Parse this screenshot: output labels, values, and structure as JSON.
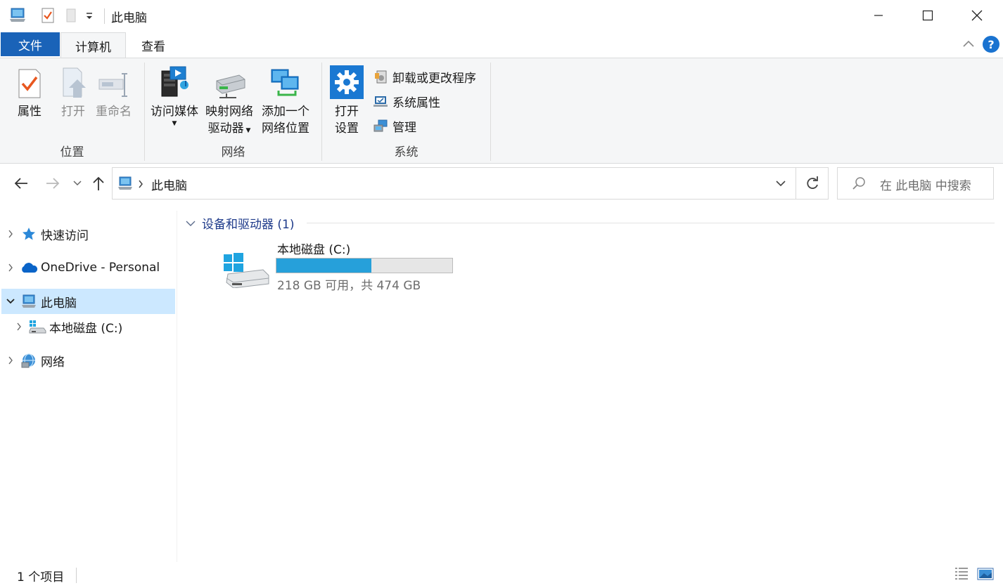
{
  "window": {
    "title": "此电脑"
  },
  "tabs": [
    {
      "label": "文件"
    },
    {
      "label": "计算机"
    },
    {
      "label": "查看"
    }
  ],
  "ribbon": {
    "help_label": "?",
    "groups": {
      "location": {
        "label": "位置",
        "properties": "属性",
        "open": "打开",
        "rename": "重命名"
      },
      "network": {
        "label": "网络",
        "access_media": "访问媒体",
        "map_drive_1": "映射网络",
        "map_drive_2": "驱动器",
        "add_location_1": "添加一个",
        "add_location_2": "网络位置"
      },
      "system": {
        "label": "系统",
        "open_settings_1": "打开",
        "open_settings_2": "设置",
        "uninstall": "卸载或更改程序",
        "sys_props": "系统属性",
        "manage": "管理"
      }
    }
  },
  "address": {
    "path": "此电脑",
    "search_placeholder": "在 此电脑 中搜索"
  },
  "nav": {
    "items": [
      {
        "label": "快速访问",
        "icon": "star-icon"
      },
      {
        "label": "OneDrive - Personal",
        "icon": "cloud-icon"
      },
      {
        "label": "此电脑",
        "icon": "computer-icon"
      },
      {
        "label": "本地磁盘 (C:)",
        "icon": "drive-icon"
      },
      {
        "label": "网络",
        "icon": "network-icon"
      }
    ]
  },
  "content": {
    "group_header": "设备和驱动器 (1)",
    "drives": [
      {
        "name": "本地磁盘 (C:)",
        "info": "218 GB 可用，共 474 GB",
        "used_fraction": 0.54
      }
    ]
  },
  "status": {
    "count": "1 个项目"
  },
  "colors": {
    "accent": "#1a63b8",
    "selected": "#cce8ff",
    "drive_bar": "#26a0da"
  }
}
